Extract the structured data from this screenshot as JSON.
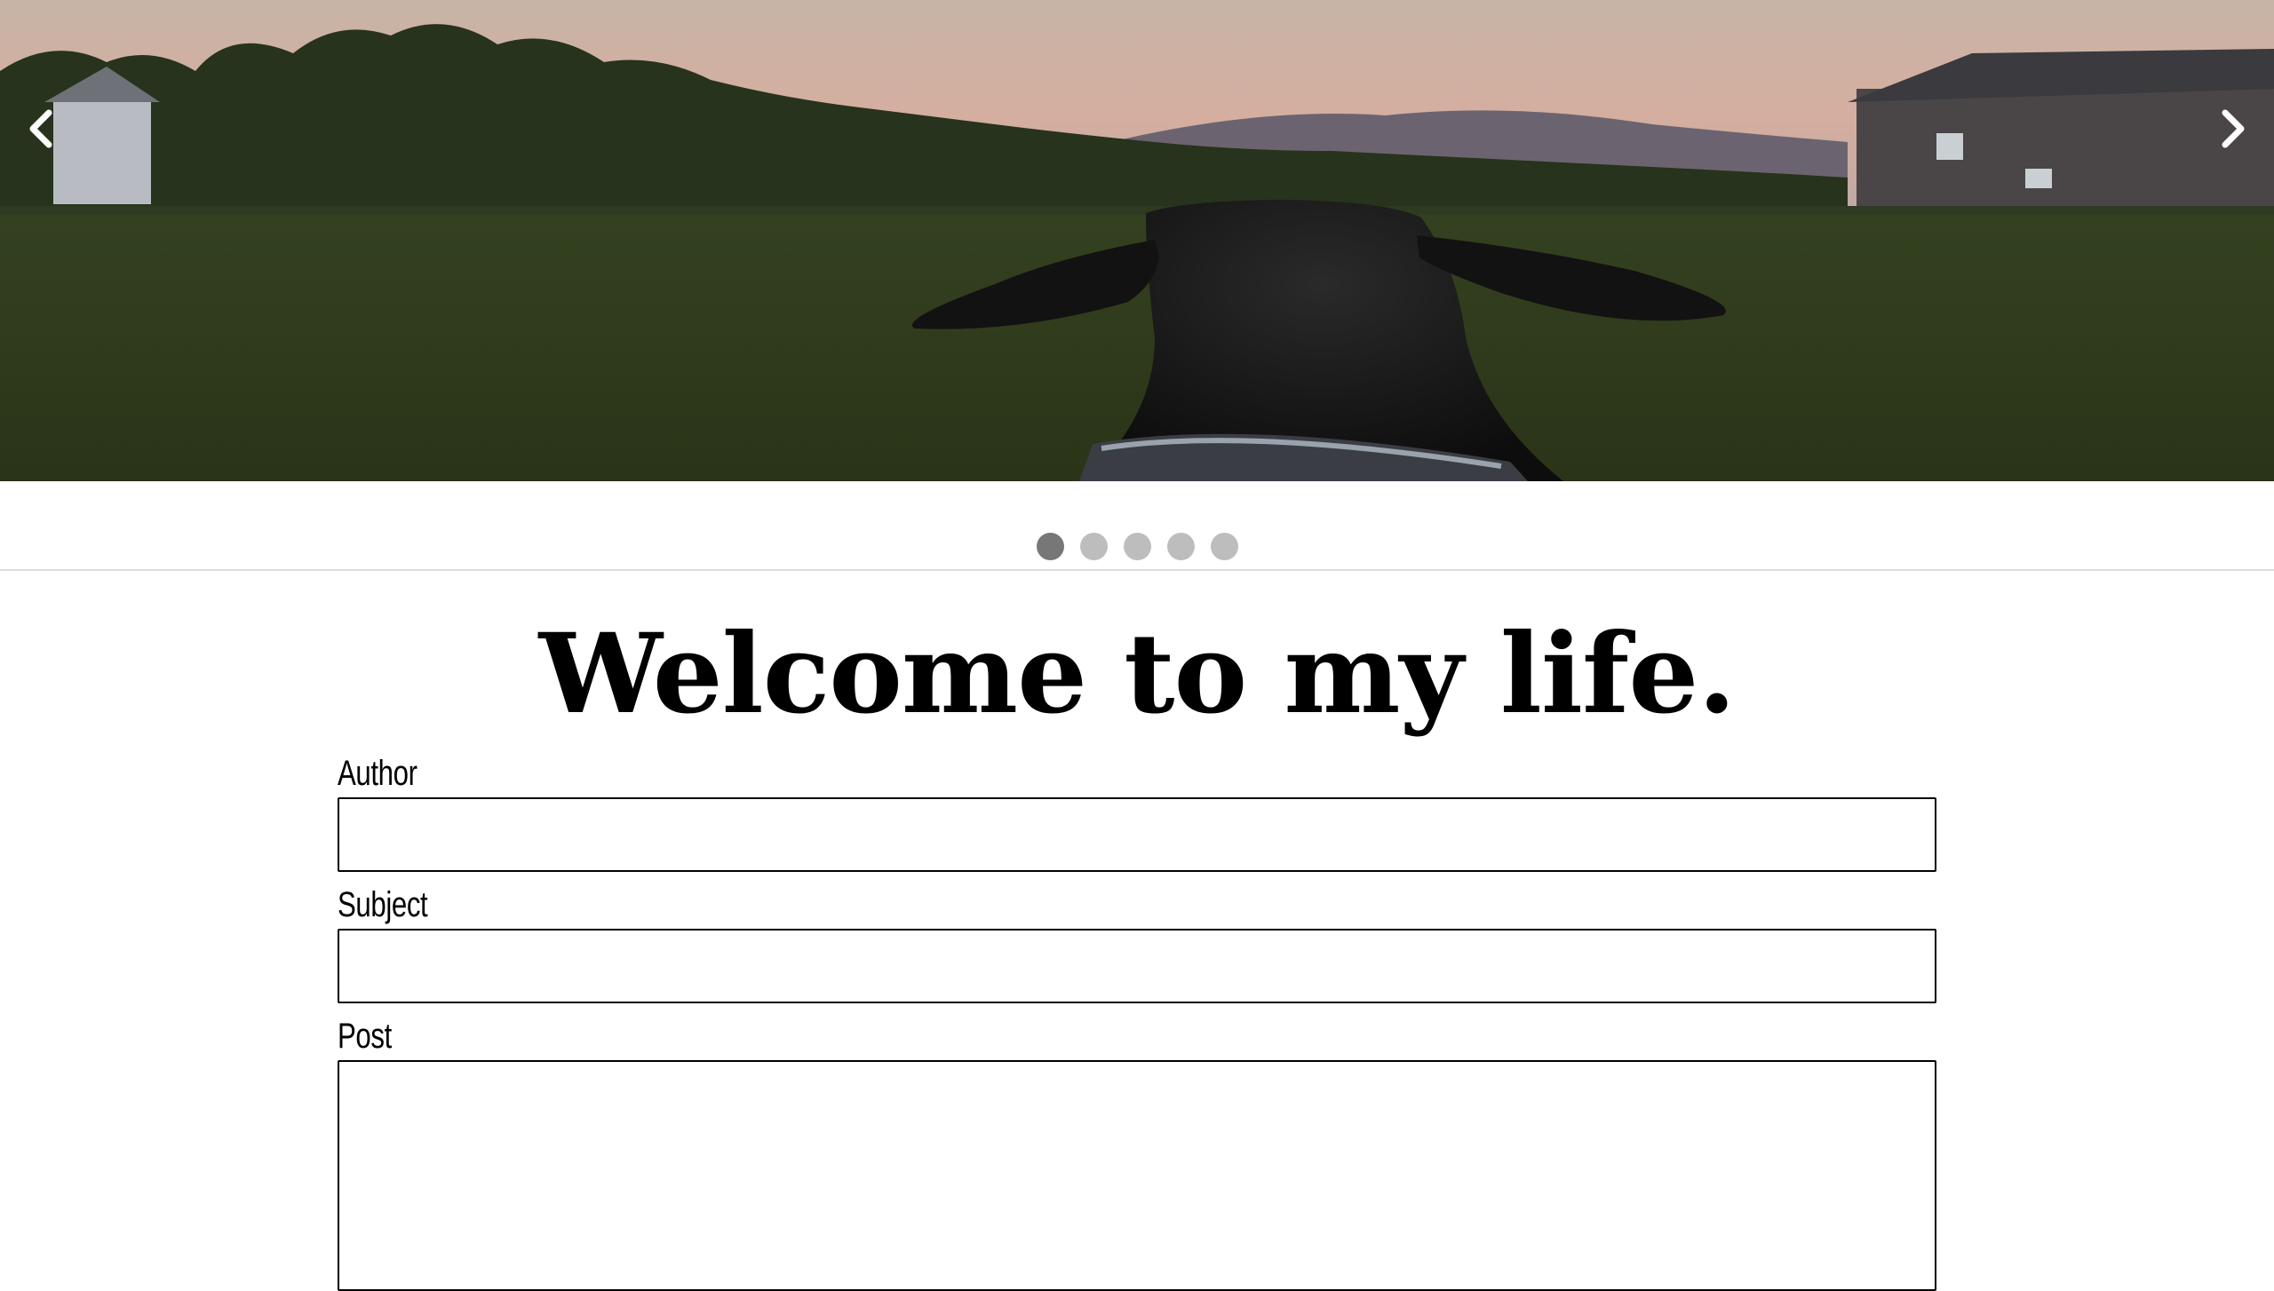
{
  "carousel": {
    "slide_image": "dog-in-park-photo",
    "prev_icon": "chevron-left-icon",
    "next_icon": "chevron-right-icon",
    "slide_count": 5,
    "active_slide": 1
  },
  "page": {
    "title": "Welcome to my life."
  },
  "form": {
    "author_label": "Author",
    "author_value": "",
    "subject_label": "Subject",
    "subject_value": "",
    "post_label": "Post",
    "post_value": ""
  },
  "colors": {
    "dot_active": "#777777",
    "dot_inactive": "#bdbdbd",
    "divider": "#dddddd",
    "text": "#000000"
  }
}
